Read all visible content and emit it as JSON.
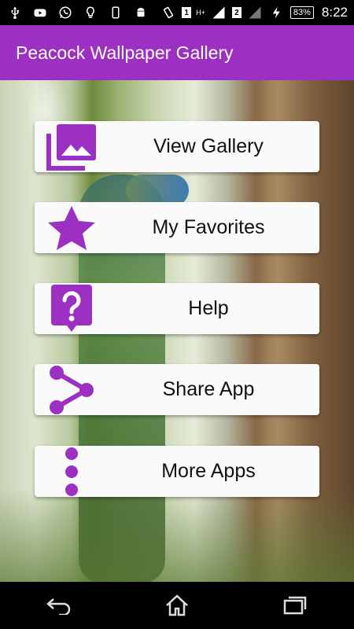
{
  "status_bar": {
    "sim1": "1",
    "sim2": "2",
    "network1": "H+",
    "battery": "83%",
    "time": "8:22",
    "icons": [
      "usb-icon",
      "youtube-icon",
      "whatsapp-icon",
      "bulb-icon",
      "phone-icon",
      "android-icon",
      "vibrate-icon",
      "signal-icon",
      "charging-icon"
    ]
  },
  "app_bar": {
    "title": "Peacock Wallpaper Gallery",
    "color": "#9b30c2"
  },
  "menu": [
    {
      "label": "View Gallery",
      "icon": "gallery-icon"
    },
    {
      "label": "My Favorites",
      "icon": "star-icon"
    },
    {
      "label": "Help",
      "icon": "help-icon"
    },
    {
      "label": "Share App",
      "icon": "share-icon"
    },
    {
      "label": "More Apps",
      "icon": "more-vertical-icon"
    }
  ],
  "accent_color": "#9b30c2",
  "nav_bar": {
    "icons": [
      "back-icon",
      "home-icon",
      "recents-icon"
    ]
  }
}
